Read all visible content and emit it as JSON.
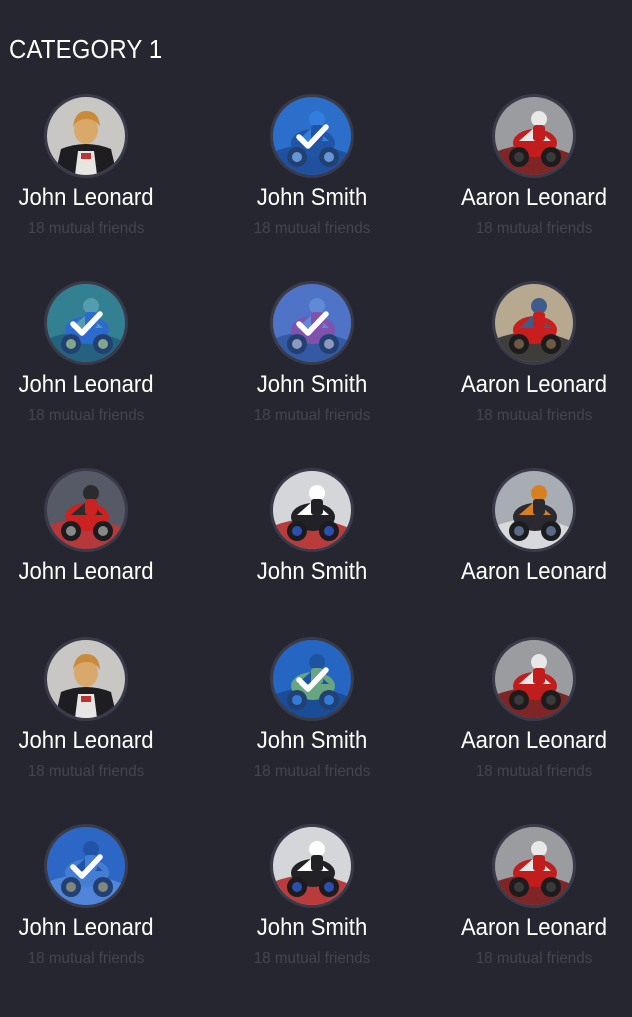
{
  "category": {
    "title": "CATEGORY 1"
  },
  "people": [
    {
      "name": "John Leonard",
      "subtitle": "18 mutual friends",
      "selected": false,
      "photo": "rider-portrait-icon"
    },
    {
      "name": "John Smith",
      "subtitle": "18 mutual friends",
      "selected": true,
      "photo": "blue-motorbike-icon"
    },
    {
      "name": "Aaron Leonard",
      "subtitle": "18 mutual friends",
      "selected": false,
      "photo": "red-motorbike-icon"
    },
    {
      "name": "John Leonard",
      "subtitle": "18 mutual friends",
      "selected": true,
      "photo": "green-track-rider-icon"
    },
    {
      "name": "John Smith",
      "subtitle": "18 mutual friends",
      "selected": true,
      "photo": "pink-motorbike-rider-icon"
    },
    {
      "name": "Aaron Leonard",
      "subtitle": "18 mutual friends",
      "selected": false,
      "photo": "red-sportbike-rider-icon"
    },
    {
      "name": "John Leonard",
      "subtitle": "",
      "selected": false,
      "photo": "motorbike-crowd-icon"
    },
    {
      "name": "John Smith",
      "subtitle": "",
      "selected": false,
      "photo": "white-superbike-icon"
    },
    {
      "name": "Aaron Leonard",
      "subtitle": "",
      "selected": false,
      "photo": "touring-rider-icon"
    },
    {
      "name": "John Leonard",
      "subtitle": "18 mutual friends",
      "selected": false,
      "photo": "rider-portrait-icon"
    },
    {
      "name": "John Smith",
      "subtitle": "18 mutual friends",
      "selected": true,
      "photo": "lime-motorbike-icon"
    },
    {
      "name": "Aaron Leonard",
      "subtitle": "18 mutual friends",
      "selected": false,
      "photo": "red-motorbike-icon"
    },
    {
      "name": "John Leonard",
      "subtitle": "18 mutual friends",
      "selected": true,
      "photo": "blue-crash-icon"
    },
    {
      "name": "John Smith",
      "subtitle": "18 mutual friends",
      "selected": false,
      "photo": "white-superbike-icon"
    },
    {
      "name": "Aaron Leonard",
      "subtitle": "18 mutual friends",
      "selected": false,
      "photo": "red-motorbike-icon"
    }
  ],
  "colors": {
    "background": "#262630",
    "avatar_ring": "#3a3b4a",
    "name_text": "#ffffff",
    "subtitle_text": "#44454f",
    "selected_overlay": "#2a6fd6"
  }
}
